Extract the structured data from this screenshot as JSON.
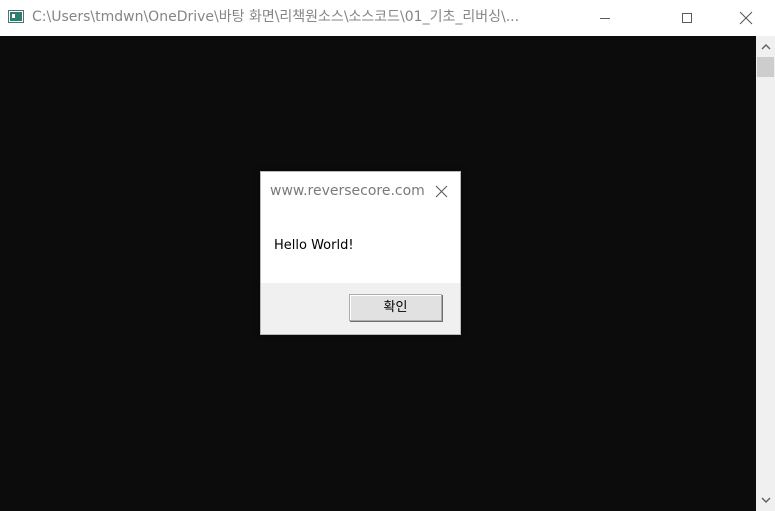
{
  "window": {
    "title": "C:\\Users\\tmdwn\\OneDrive\\바탕 화면\\리책원소스\\소스코드\\01_기초_리버싱\\...",
    "title_color": "#858585",
    "icons": {
      "app": "console-window-icon",
      "minimize": "minimize-icon",
      "maximize": "maximize-icon",
      "close": "close-icon"
    }
  },
  "console": {
    "background": "#0c0c0c"
  },
  "scrollbar": {
    "up_icon": "chevron-up-icon",
    "down_icon": "chevron-down-icon"
  },
  "message_box": {
    "title": "www.reversecore.com",
    "message": "Hello World!",
    "ok_label": "확인",
    "close_icon": "close-icon"
  }
}
